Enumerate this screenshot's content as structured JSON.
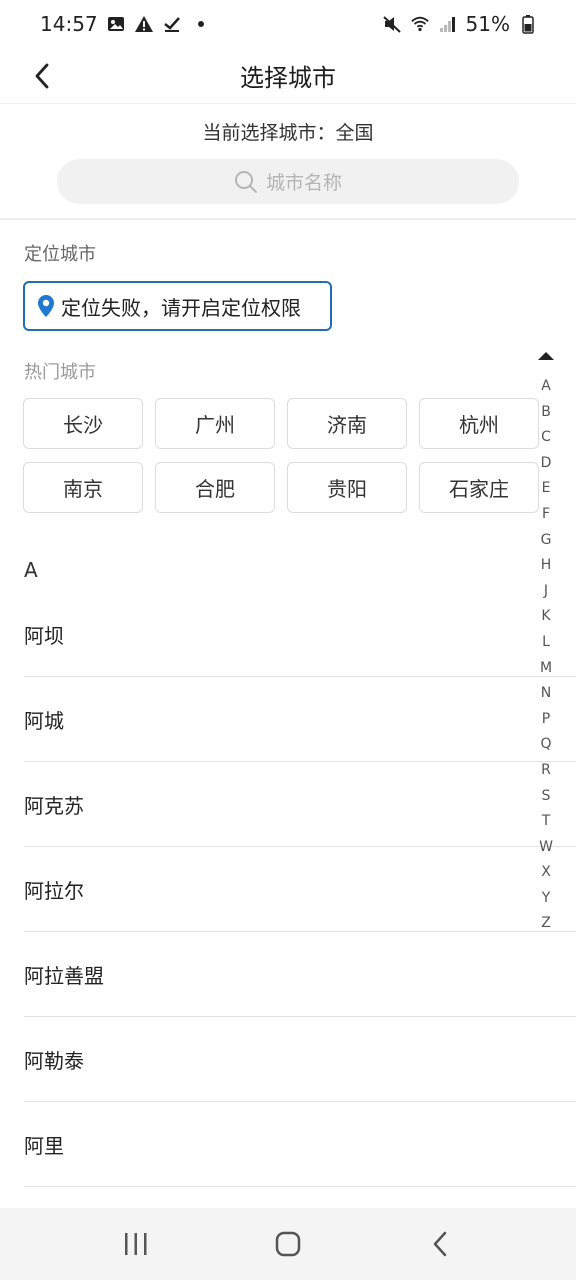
{
  "status_bar": {
    "time": "14:57",
    "battery": "51%",
    "icons": [
      "image-icon",
      "warning-icon",
      "check-icon",
      "dot-icon",
      "mute-icon",
      "wifi-icon",
      "signal-icon",
      "battery-icon"
    ]
  },
  "header": {
    "title": "选择城市",
    "back_icon": "chevron-left-icon"
  },
  "current_city": "当前选择城市：全国",
  "search": {
    "placeholder": "城市名称",
    "icon": "search-icon"
  },
  "location": {
    "section_label": "定位城市",
    "status_text": "定位失败，请开启定位权限",
    "icon": "location-pin-icon",
    "accent_color": "#1f6fb6"
  },
  "hot": {
    "section_label": "热门城市",
    "cities": [
      "长沙",
      "广州",
      "济南",
      "杭州",
      "南京",
      "合肥",
      "贵阳",
      "石家庄"
    ]
  },
  "list": {
    "letter": "A",
    "cities": [
      "阿坝",
      "阿城",
      "阿克苏",
      "阿拉尔",
      "阿拉善盟",
      "阿勒泰",
      "阿里"
    ]
  },
  "index_bar": {
    "letters": [
      "A",
      "B",
      "C",
      "D",
      "E",
      "F",
      "G",
      "H",
      "J",
      "K",
      "L",
      "M",
      "N",
      "P",
      "Q",
      "R",
      "S",
      "T",
      "W",
      "X",
      "Y",
      "Z"
    ]
  },
  "nav": {
    "icons": [
      "recent-apps-icon",
      "home-icon",
      "back-icon"
    ]
  }
}
